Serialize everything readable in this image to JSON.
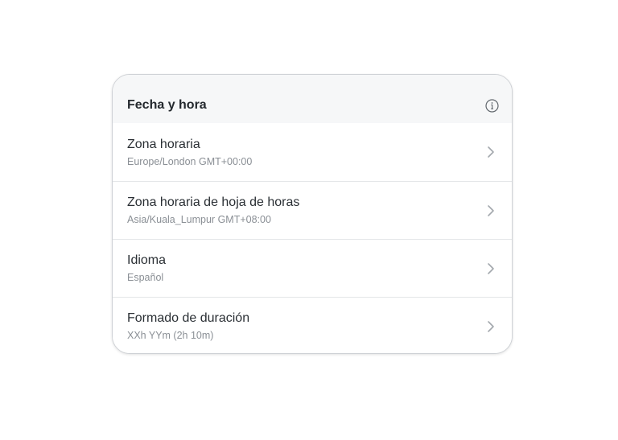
{
  "card": {
    "title": "Fecha y hora",
    "info_icon": "info-icon",
    "items": [
      {
        "label": "Zona horaria",
        "value": "Europe/London GMT+00:00",
        "icon": "chevron-right-icon"
      },
      {
        "label": "Zona horaria de hoja de horas",
        "value": "Asia/Kuala_Lumpur GMT+08:00",
        "icon": "chevron-right-icon"
      },
      {
        "label": "Idioma",
        "value": "Español",
        "icon": "chevron-right-icon"
      },
      {
        "label": "Formado de duración",
        "value": "XXh YYm (2h 10m)",
        "icon": "chevron-right-icon"
      }
    ]
  },
  "colors": {
    "header_bg": "#f6f7f8",
    "border": "#cfd2d6",
    "title_text": "#24292e",
    "secondary_text": "#8a8f95",
    "chevron": "#a3a8ad"
  }
}
